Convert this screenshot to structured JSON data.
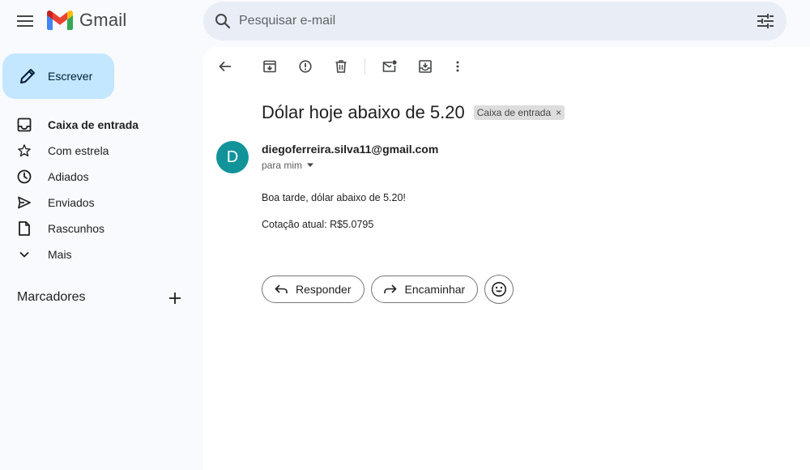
{
  "header": {
    "app_name": "Gmail",
    "search_placeholder": "Pesquisar e-mail"
  },
  "sidebar": {
    "compose_label": "Escrever",
    "items": [
      {
        "label": "Caixa de entrada",
        "icon": "inbox-icon",
        "active": true
      },
      {
        "label": "Com estrela",
        "icon": "star-icon"
      },
      {
        "label": "Adiados",
        "icon": "clock-icon"
      },
      {
        "label": "Enviados",
        "icon": "send-icon"
      },
      {
        "label": "Rascunhos",
        "icon": "draft-icon"
      },
      {
        "label": "Mais",
        "icon": "chevron-down-icon"
      }
    ],
    "labels_title": "Marcadores"
  },
  "message": {
    "subject": "Dólar hoje abaixo de 5.20",
    "label_chip": "Caixa de entrada",
    "avatar_letter": "D",
    "avatar_color": "#12939a",
    "sender": "diegoferreira.silva11@gmail.com",
    "to": "para mim",
    "body_line1": "Boa tarde, dólar abaixo de 5.20!",
    "body_line2": "Cotação atual: R$5.0795"
  },
  "actions": {
    "reply_label": "Responder",
    "forward_label": "Encaminhar"
  },
  "colors": {
    "compose_bg": "#c2e7ff",
    "search_bg": "#e9eef6",
    "app_bg": "#f8fafd"
  }
}
